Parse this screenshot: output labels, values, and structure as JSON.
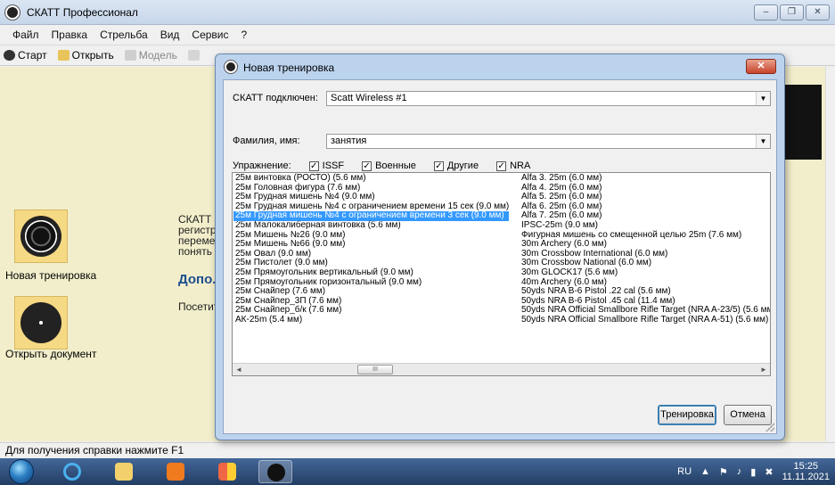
{
  "window": {
    "title": "СКАТТ Профессионал",
    "buttons": [
      "▭",
      "🗗",
      "✕"
    ]
  },
  "menu": [
    "Файл",
    "Правка",
    "Стрельба",
    "Вид",
    "Сервис",
    "?"
  ],
  "toolbar": {
    "start": "Старт",
    "open": "Открыть",
    "model": "Модель"
  },
  "left_panel": {
    "new_training": "Новая тренировка",
    "open_document": "Открыть документ"
  },
  "welcome": {
    "lines": [
      "СКАТТ -",
      "регистр",
      "переме",
      "понять"
    ],
    "more": "Допо.",
    "visit": "Посетит"
  },
  "status": "Для получения справки нажмите F1",
  "tray": {
    "lang": "RU",
    "time": "15:25",
    "date": "11.11.2021"
  },
  "dialog": {
    "title": "Новая тренировка",
    "close": "✕",
    "scatt_label": "СКАТТ подключен:",
    "scatt_value": "Scatt Wireless #1",
    "name_label": "Фамилия, имя:",
    "name_value": "занятия",
    "exercise_label": "Упражнение:",
    "filters": [
      {
        "label": "ISSF",
        "checked": true
      },
      {
        "label": "Военные",
        "checked": true
      },
      {
        "label": "Другие",
        "checked": true
      },
      {
        "label": "NRA",
        "checked": true
      }
    ],
    "list_col1": [
      "25м винтовка (РОСТО) (5.6 мм)",
      "25м Головная фигура (7.6 мм)",
      "25м Грудная мишень №4 (9.0 мм)",
      "25м Грудная мишень №4 с ограничением времени 15 сек (9.0 мм)",
      "25м Грудная мишень №4 с ограничением времени 3 сек (9.0 мм)",
      "25м Малокалиберная винтовка (5.6 мм)",
      "25м Мишень №26 (9.0 мм)",
      "25м Мишень №66 (9.0 мм)",
      "25м Овал (9.0 мм)",
      "25м Пистолет (9.0 мм)",
      "25м Прямоугольник вертикальный (9.0 мм)",
      "25м Прямоугольник горизонтальный (9.0 мм)",
      "25м Снайпер (7.6 мм)",
      "25м Снайпер_3П (7.6 мм)",
      "25м Снайпер_б/к (7.6 мм)",
      "АК-25m (5.4 мм)"
    ],
    "selected_index": 4,
    "list_col2": [
      "Alfa 3. 25m (6.0 мм)",
      "Alfa 4. 25m (6.0 мм)",
      "Alfa 5. 25m (6.0 мм)",
      "Alfa 6. 25m (6.0 мм)",
      "Alfa 7. 25m (6.0 мм)",
      "IPSC-25m (9.0 мм)",
      "Фигурная мишень со смещенной целью 25m (7.6 мм)",
      "30m Archery (6.0 мм)",
      "30m Crossbow International (6.0 мм)",
      "30m Crossbow National (6.0 мм)",
      "30m GLOCK17 (5.6 мм)",
      "40m Archery (6.0 мм)",
      "50yds NRA B-6 Pistol .22 cal (5.6 мм)",
      "50yds NRA B-6 Pistol .45 cal (11.4 мм)",
      "50yds NRA Official Smallbore Rifle Target (NRA A-23/5) (5.6 мм)",
      "50yds NRA Official Smallbore Rifle Target (NRA A-51) (5.6 мм)"
    ],
    "scroll_left": "◄",
    "scroll_right": "►",
    "scroll_thumb": "III",
    "train_button": "Тренировка",
    "cancel_button": "Отмена"
  }
}
